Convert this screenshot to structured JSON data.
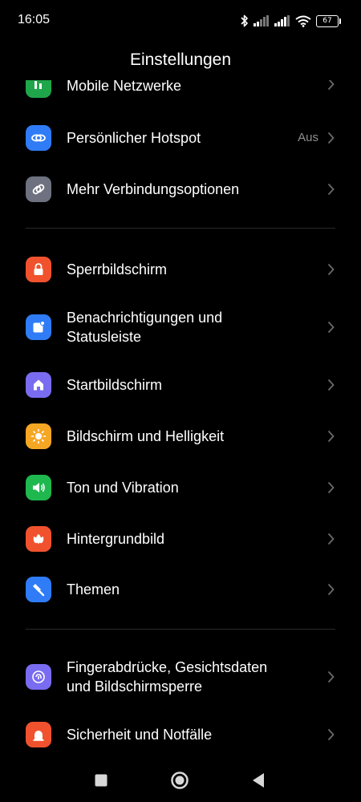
{
  "status": {
    "time": "16:05",
    "battery": "67"
  },
  "header": {
    "title": "Einstellungen"
  },
  "items": [
    {
      "label": "Mobile Netzwerke",
      "icon": "mobile-network-icon",
      "color": "#1fa64b"
    },
    {
      "label": "Persönlicher Hotspot",
      "value": "Aus",
      "icon": "hotspot-icon",
      "color": "#2f7cf6"
    },
    {
      "label": "Mehr Verbindungsoptionen",
      "icon": "link-icon",
      "color": "#6e7180"
    },
    {
      "label": "Sperrbildschirm",
      "icon": "lock-icon",
      "color": "#f0522e"
    },
    {
      "label": "Benachrichtigungen und\nStatusleiste",
      "icon": "notification-icon",
      "color": "#2f7cf6"
    },
    {
      "label": "Startbildschirm",
      "icon": "home-icon",
      "color": "#7a6cf0"
    },
    {
      "label": "Bildschirm und Helligkeit",
      "icon": "sun-icon",
      "color": "#f5a623"
    },
    {
      "label": "Ton und Vibration",
      "icon": "speaker-icon",
      "color": "#1fb84f"
    },
    {
      "label": "Hintergrundbild",
      "icon": "flower-icon",
      "color": "#f0522e"
    },
    {
      "label": "Themen",
      "icon": "brush-icon",
      "color": "#2f7cf6"
    },
    {
      "label": "Fingerabdrücke, Gesichtsdaten\nund Bildschirmsperre",
      "icon": "fingerprint-icon",
      "color": "#7a6cf0"
    },
    {
      "label": "Sicherheit und Notfälle",
      "icon": "emergency-icon",
      "color": "#f0522e"
    }
  ]
}
